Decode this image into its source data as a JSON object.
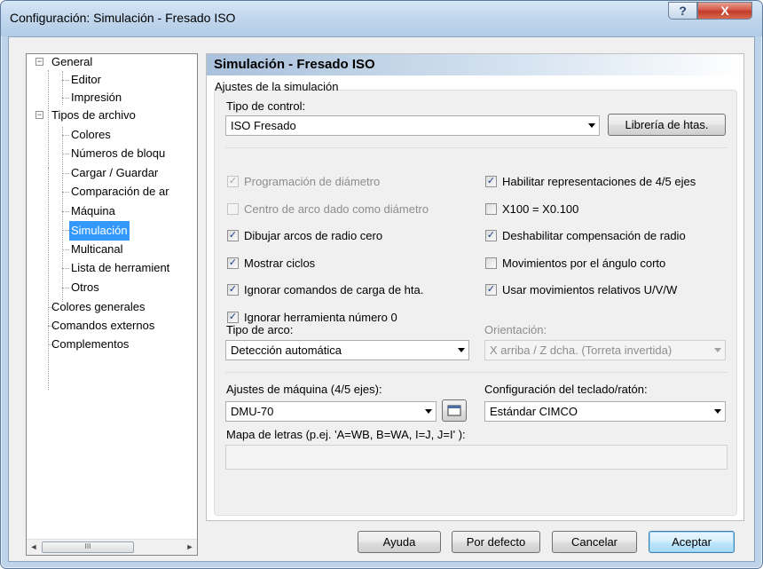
{
  "window": {
    "title": "Configuración: Simulación - Fresado ISO",
    "help_glyph": "?",
    "close_glyph": "X"
  },
  "tree": {
    "items": [
      {
        "label": "General",
        "expander": "−"
      },
      {
        "label": "Editor"
      },
      {
        "label": "Impresión"
      },
      {
        "label": "Tipos de archivo",
        "expander": "−"
      },
      {
        "label": "Colores"
      },
      {
        "label": "Números de bloqu"
      },
      {
        "label": "Cargar / Guardar"
      },
      {
        "label": "Comparación de ar"
      },
      {
        "label": "Máquina"
      },
      {
        "label": "Simulación",
        "selected": true
      },
      {
        "label": "Multicanal"
      },
      {
        "label": "Lista de herramient"
      },
      {
        "label": "Otros"
      },
      {
        "label": "Colores generales"
      },
      {
        "label": "Comandos externos"
      },
      {
        "label": "Complementos"
      }
    ],
    "scroll_left": "◄",
    "scroll_right": "►",
    "scroll_grip": "III"
  },
  "panel": {
    "header": "Simulación - Fresado ISO",
    "group_title": "Ajustes de la simulación",
    "control_type_label": "Tipo de control:",
    "control_type_value": "ISO Fresado",
    "tool_library_button": "Librería de htas.",
    "checkboxes_left": [
      {
        "label": "Programación de diámetro",
        "checked": true,
        "disabled": true
      },
      {
        "label": "Centro de arco dado como diámetro",
        "checked": false,
        "disabled": true
      },
      {
        "label": "Dibujar arcos de radio cero",
        "checked": true,
        "disabled": false
      },
      {
        "label": "Mostrar ciclos",
        "checked": true,
        "disabled": false
      },
      {
        "label": "Ignorar comandos de carga de hta.",
        "checked": true,
        "disabled": false
      },
      {
        "label": "Ignorar herramienta número 0",
        "checked": true,
        "disabled": false
      }
    ],
    "checkboxes_right": [
      {
        "label": "Habilitar representaciones de 4/5 ejes",
        "checked": true
      },
      {
        "label": "X100 = X0.100",
        "checked": false
      },
      {
        "label": "Deshabilitar compensación de radio",
        "checked": true
      },
      {
        "label": "Movimientos por el ángulo corto",
        "checked": false
      },
      {
        "label": "Usar movimientos relativos U/V/W",
        "checked": true
      }
    ],
    "arc_type_label": "Tipo de arco:",
    "arc_type_value": "Detección automática",
    "orientation_label": "Orientación:",
    "orientation_value": "X arriba / Z dcha. (Torreta invertida)",
    "machine_label": "Ajustes de máquina (4/5 ejes):",
    "machine_value": "DMU-70",
    "keyboard_label": "Configuración del teclado/ratón:",
    "keyboard_value": "Estándar CIMCO",
    "letter_map_label": "Mapa de letras (p.ej. 'A=WB, B=WA, I=J, J=I' ):",
    "letter_map_value": ""
  },
  "footer": {
    "help": "Ayuda",
    "defaults": "Por defecto",
    "cancel": "Cancelar",
    "accept": "Aceptar"
  },
  "check_glyph": "✓"
}
